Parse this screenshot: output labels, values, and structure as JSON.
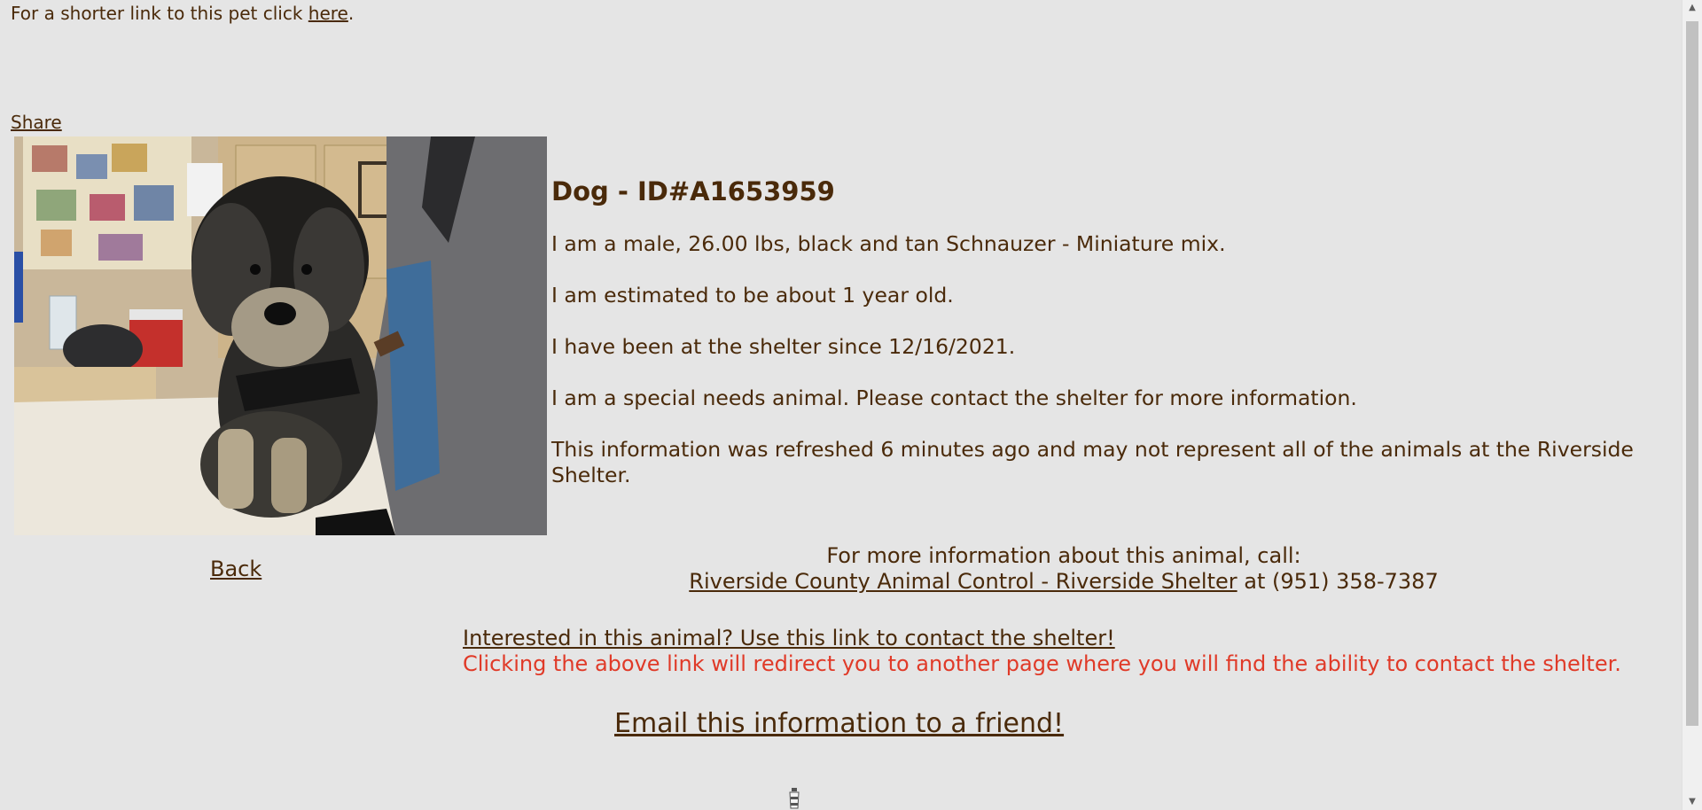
{
  "header": {
    "shorter_link_prefix": "For a shorter link to this pet click ",
    "shorter_link_text": "here",
    "shorter_link_suffix": "."
  },
  "share": {
    "label": "Share"
  },
  "pet": {
    "title": "Dog - ID#A1653959",
    "description": "I am a male, 26.00 lbs, black and tan Schnauzer - Miniature mix.",
    "age": "I am estimated to be about 1 year old.",
    "since": "I have been at the shelter since 12/16/2021.",
    "special_needs": "I am a special needs animal. Please contact the shelter for more information.",
    "refresh_note": "This information was refreshed 6 minutes ago and may not represent all of the animals at the Riverside Shelter."
  },
  "back": {
    "label": "Back"
  },
  "call": {
    "intro": "For more information about this animal, call:",
    "shelter_link": "Riverside County Animal Control - Riverside Shelter",
    "phone_text": " at (951) 358-7387"
  },
  "contact": {
    "link": "Interested in this animal? Use this link to contact the shelter!",
    "warning": "Clicking the above link will redirect you to another page where you will find the ability to contact the shelter.",
    "warning_color": "#e03a28"
  },
  "email": {
    "label": "Email this information to a friend!"
  },
  "colors": {
    "background": "#e5e5e5",
    "text": "#4a2a0a"
  },
  "icons": {
    "photo": "dog-photo",
    "bottom": "lighthouse-icon",
    "scroll_up": "chevron-up-icon",
    "scroll_down": "chevron-down-icon"
  }
}
